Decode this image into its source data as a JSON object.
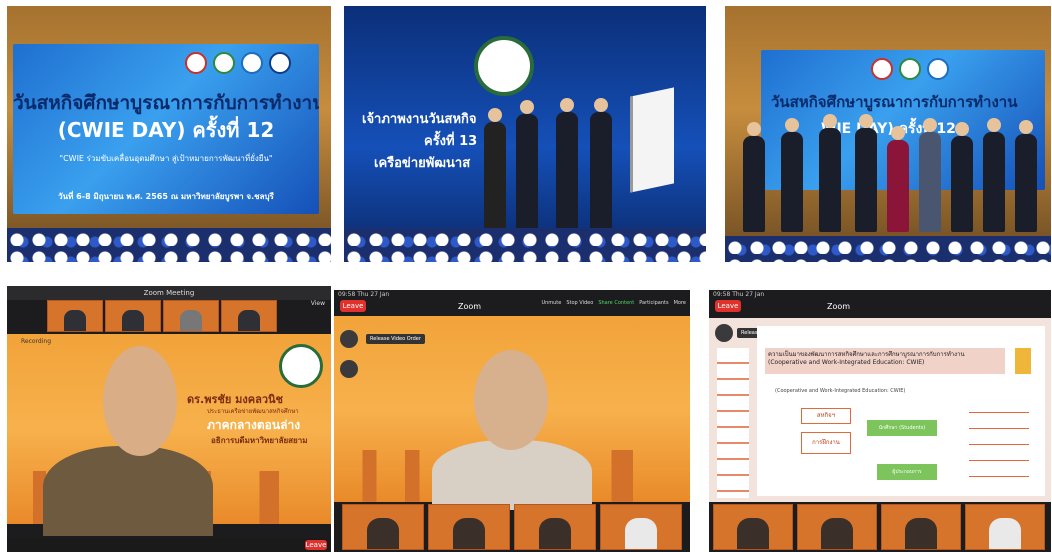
{
  "photo1": {
    "title_line1": "วันสหกิจศึกษาบูรณาการกับการทำงาน",
    "title_line2": "(CWIE DAY) ครั้งที่ 12",
    "subtitle": "\"CWIE ร่วมขับเคลื่อนอุดมศึกษา สู่เป้าหมายการพัฒนาที่ยั่งยืน\"",
    "date_line": "วันที่ 6-8 มิถุนายน พ.ศ. 2565 ณ มหาวิทยาลัยบูรพา จ.ชลบุรี"
  },
  "photo2": {
    "line1": "เจ้าภาพงานวันสหกิจ",
    "line2": "ครั้งที่ 13",
    "line3": "เครือข่ายพัฒนาส"
  },
  "photo3": {
    "title_line1": "วันสหกิจศึกษาบูรณาการกับการทำงาน",
    "title_line2": "WIE DAY) ครั้งที่ 12"
  },
  "zoom1": {
    "window_title": "Zoom Meeting",
    "view_label": "View",
    "recording_label": "Recording",
    "speaker_name": "ดร.พรชัย มงคลวนิช",
    "speaker_role": "ประธานเครือข่ายพัฒนาสหกิจศึกษา",
    "region_label": "ภาคกลางตอนล่าง",
    "org_label": "อธิการบดีมหาวิทยาลัยสยาม",
    "leave_label": "Leave"
  },
  "zoom2": {
    "status_time": "09:58  Thu 27 Jan",
    "app_label": "Zoom",
    "leave_label": "Leave",
    "release_label": "Release Video Order",
    "controls": [
      "Unmute",
      "Stop Video",
      "Share Content",
      "Participants",
      "More"
    ]
  },
  "zoom3": {
    "status_time": "09:58  Thu 27 Jan",
    "app_label": "Zoom",
    "leave_label": "Leave",
    "release_label": "Release Video Order",
    "slide_heading": "ความเป็นมาของพัฒนาการสหกิจศึกษาและการศึกษาบูรณาการกับการทำงาน (Cooperative and Work-Integrated Education: CWIE)",
    "slide_sub": "(Cooperative and Work-Integrated Education: CWIE)",
    "node_main": "สหกิจฯ",
    "node_sub": "การฝึกงาน",
    "node_side": "ผู้ประกอบการ",
    "node_student": "นักศึกษา (Students)"
  },
  "colors": {
    "zoom_leave": "#e0312c",
    "event_orange": "#f2a33a",
    "stage_blue": "#1f6fd0"
  }
}
